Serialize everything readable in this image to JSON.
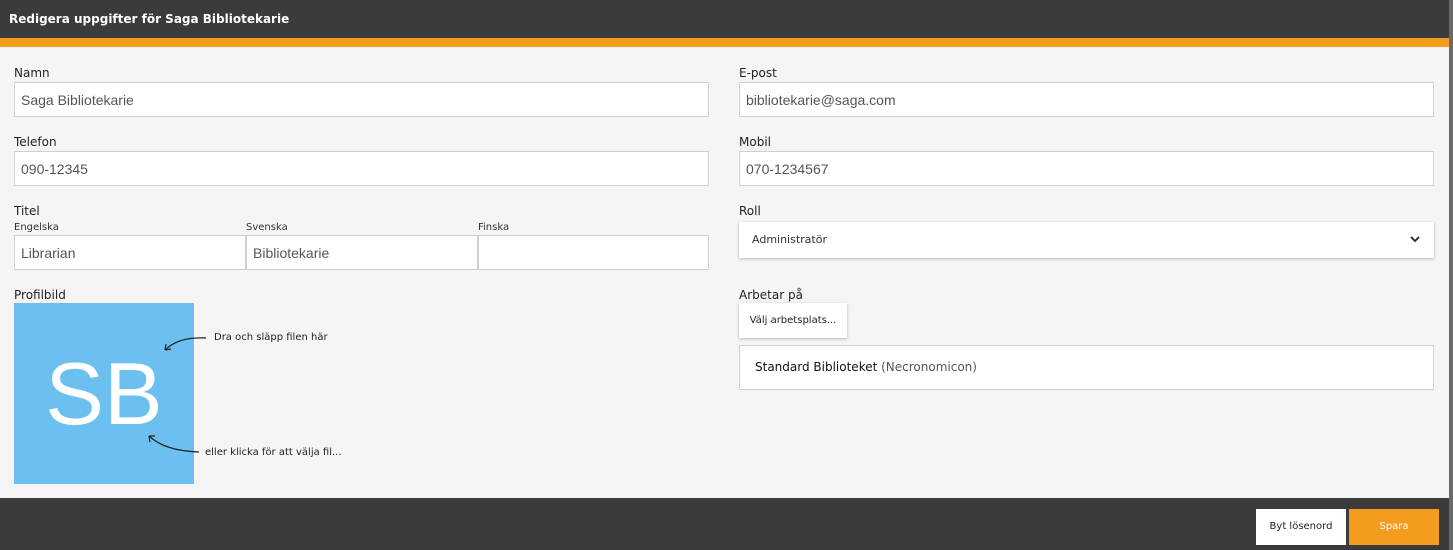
{
  "header": {
    "title": "Redigera uppgifter för Saga Bibliotekarie"
  },
  "colors": {
    "accent": "#f39c1e",
    "avatar_bg": "#6cc0f0",
    "chrome": "#3b3b3b"
  },
  "form": {
    "name": {
      "label": "Namn",
      "value": "Saga Bibliotekarie"
    },
    "email": {
      "label": "E-post",
      "value": "bibliotekarie@saga.com"
    },
    "phone": {
      "label": "Telefon",
      "value": "090-12345"
    },
    "mobile": {
      "label": "Mobil",
      "value": "070-1234567"
    },
    "title": {
      "label": "Titel",
      "english": {
        "label": "Engelska",
        "value": "Librarian"
      },
      "swedish": {
        "label": "Svenska",
        "value": "Bibliotekarie"
      },
      "finnish": {
        "label": "Finska",
        "value": ""
      }
    },
    "role": {
      "label": "Roll",
      "value": "Administratör",
      "icon": "chevron-down-icon"
    },
    "profile": {
      "label": "Profilbild",
      "initials": "SB",
      "drop_hint": "Dra och släpp filen här",
      "click_hint": "eller klicka för att välja fil..."
    },
    "works_at": {
      "label": "Arbetar på",
      "choose_label": "Välj arbetsplats...",
      "workplace_name": "Standard Biblioteket",
      "workplace_org": "(Necronomicon)"
    }
  },
  "footer": {
    "change_password_label": "Byt lösenord",
    "save_label": "Spara"
  }
}
